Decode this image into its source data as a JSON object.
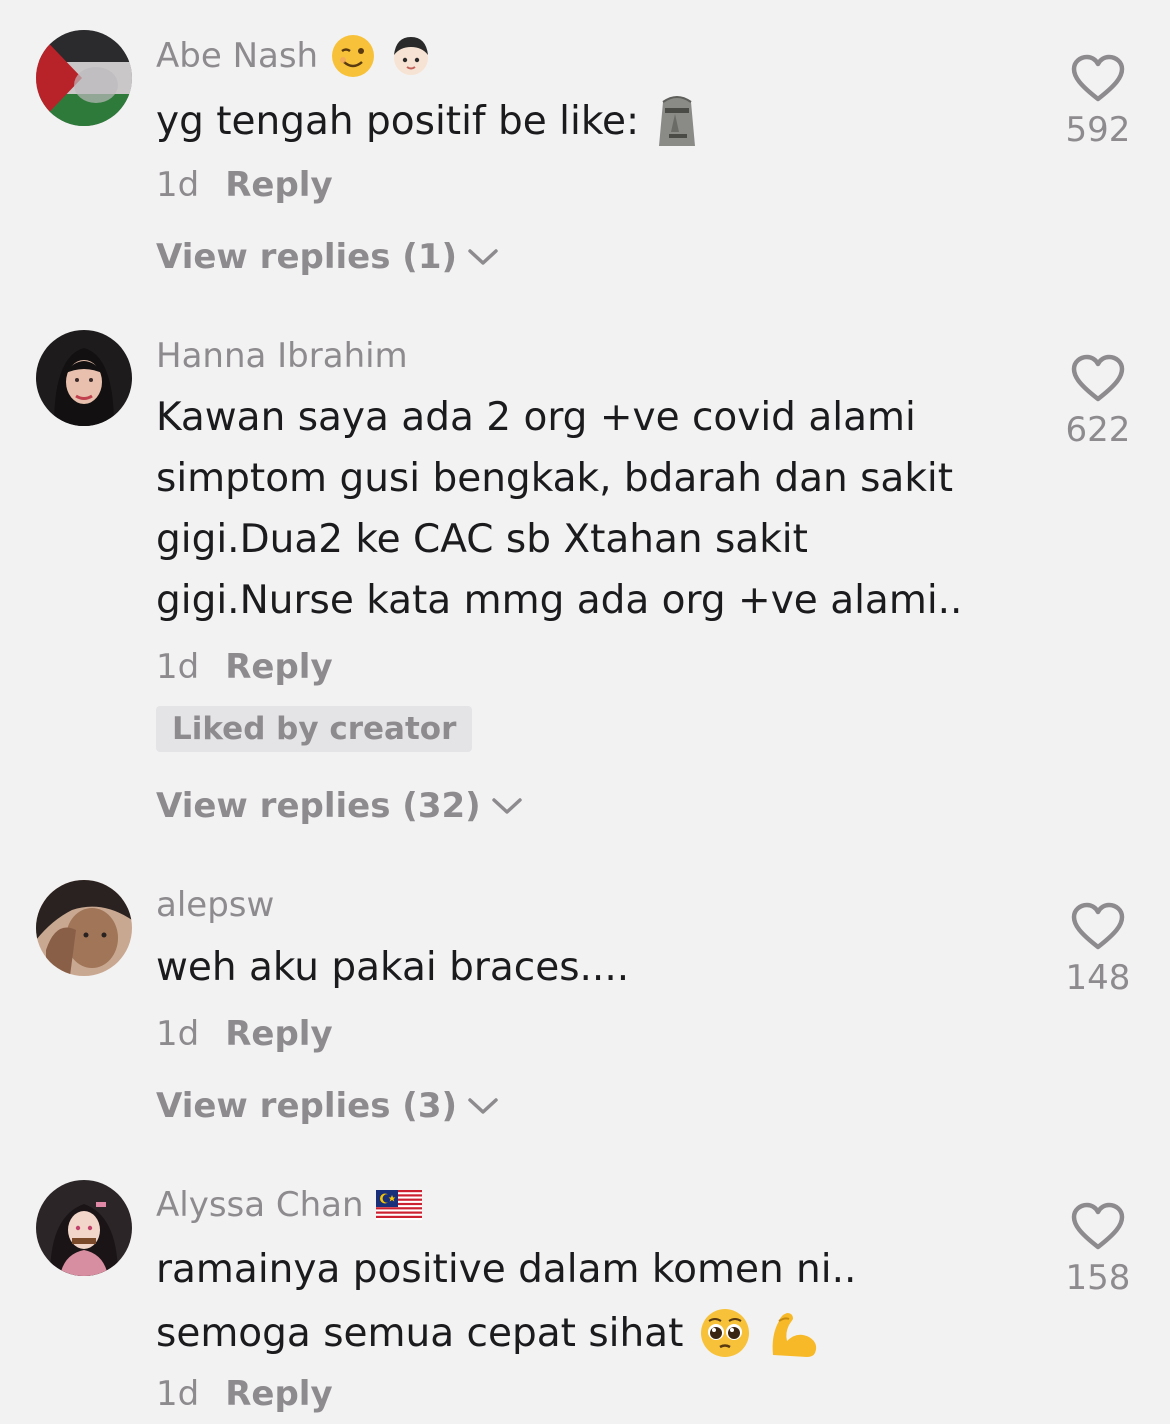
{
  "comments": [
    {
      "username": "Abe Nash",
      "username_emojis": [
        "wink-face-emoji",
        "child-emoji"
      ],
      "lines": [
        "yg tengah positif be like:"
      ],
      "text_emojis": [
        "moai-emoji"
      ],
      "time": "1d",
      "reply_label": "Reply",
      "view_replies": "View replies (1)",
      "likes": "592"
    },
    {
      "username": "Hanna Ibrahim",
      "lines": [
        "Kawan saya ada 2 org +ve covid alami",
        "simptom gusi bengkak, bdarah dan sakit",
        "gigi.Dua2 ke CAC sb Xtahan sakit",
        "gigi.Nurse kata mmg ada org +ve alami.."
      ],
      "time": "1d",
      "reply_label": "Reply",
      "badge": "Liked by creator",
      "view_replies": "View replies (32)",
      "likes": "622"
    },
    {
      "username": "alepsw",
      "lines": [
        "weh aku pakai braces...."
      ],
      "time": "1d",
      "reply_label": "Reply",
      "view_replies": "View replies (3)",
      "likes": "148"
    },
    {
      "username": "Alyssa Chan",
      "username_emojis": [
        "malaysia-flag-emoji"
      ],
      "lines": [
        "ramainya positive dalam komen ni..",
        "semoga semua cepat sihat"
      ],
      "text_emojis": [
        "pleading-face-emoji",
        "flexed-biceps-emoji"
      ],
      "time": "1d",
      "reply_label": "Reply",
      "likes": "158"
    }
  ],
  "colors": {
    "background": "#f3f2f3",
    "primary_text": "#1b1a1d",
    "secondary_text": "#8e8b8f",
    "badge_bg": "#e4e3e5"
  }
}
